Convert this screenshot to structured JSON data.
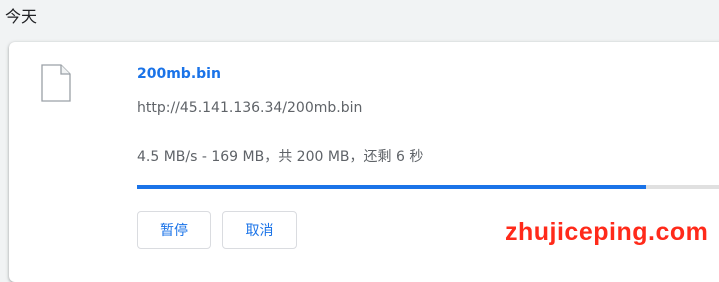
{
  "section": {
    "date_label": "今天"
  },
  "download": {
    "file_name": "200mb.bin",
    "url": "http://45.141.136.34/200mb.bin",
    "status": "4.5 MB/s - 169 MB，共 200 MB，还剩 6 秒",
    "progress_fraction": 0.845,
    "icon": "file-icon"
  },
  "actions": {
    "pause_label": "暂停",
    "cancel_label": "取消"
  },
  "watermark": {
    "text": "zhujiceping.com"
  },
  "colors": {
    "accent": "#1a73e8",
    "watermark": "#ff2a1a"
  }
}
